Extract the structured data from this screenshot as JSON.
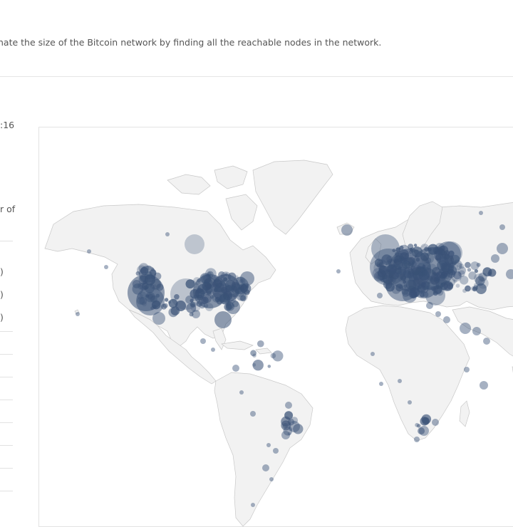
{
  "intro_text": "nate the size of the Bitcoin network by finding all the reachable nodes in the network.",
  "left_fragments": [
    ":16",
    "r of",
    ")",
    ")",
    ")"
  ],
  "map": {
    "land_color": "#f2f2f2",
    "border_color": "#c8c8c8",
    "node_color": "#3a5277"
  }
}
